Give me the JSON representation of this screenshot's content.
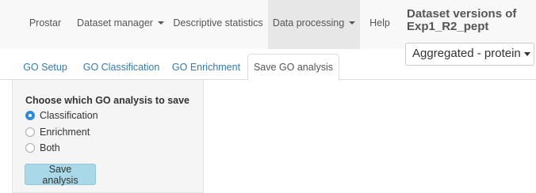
{
  "navbar": {
    "items": [
      {
        "label": "Prostar"
      },
      {
        "label": "Dataset manager"
      },
      {
        "label": "Descriptive statistics"
      },
      {
        "label": "Data processing"
      },
      {
        "label": "Help"
      }
    ],
    "version_title": "Dataset versions of Exp1_R2_pept",
    "version_select": "Aggregated - protein"
  },
  "tabs": [
    {
      "label": "GO Setup"
    },
    {
      "label": "GO Classification"
    },
    {
      "label": "GO Enrichment"
    },
    {
      "label": "Save GO analysis"
    }
  ],
  "panel": {
    "label": "Choose which GO analysis to save",
    "options": [
      {
        "label": "Classification",
        "checked": true
      },
      {
        "label": "Enrichment",
        "checked": false
      },
      {
        "label": "Both",
        "checked": false
      }
    ],
    "save_label": "Save analysis"
  },
  "colors": {
    "link": "#337ab7",
    "radio_checked": "#2e8ddb",
    "save_button_bg": "#a9d9e8",
    "active_nav_bg": "#e7e7e7"
  }
}
